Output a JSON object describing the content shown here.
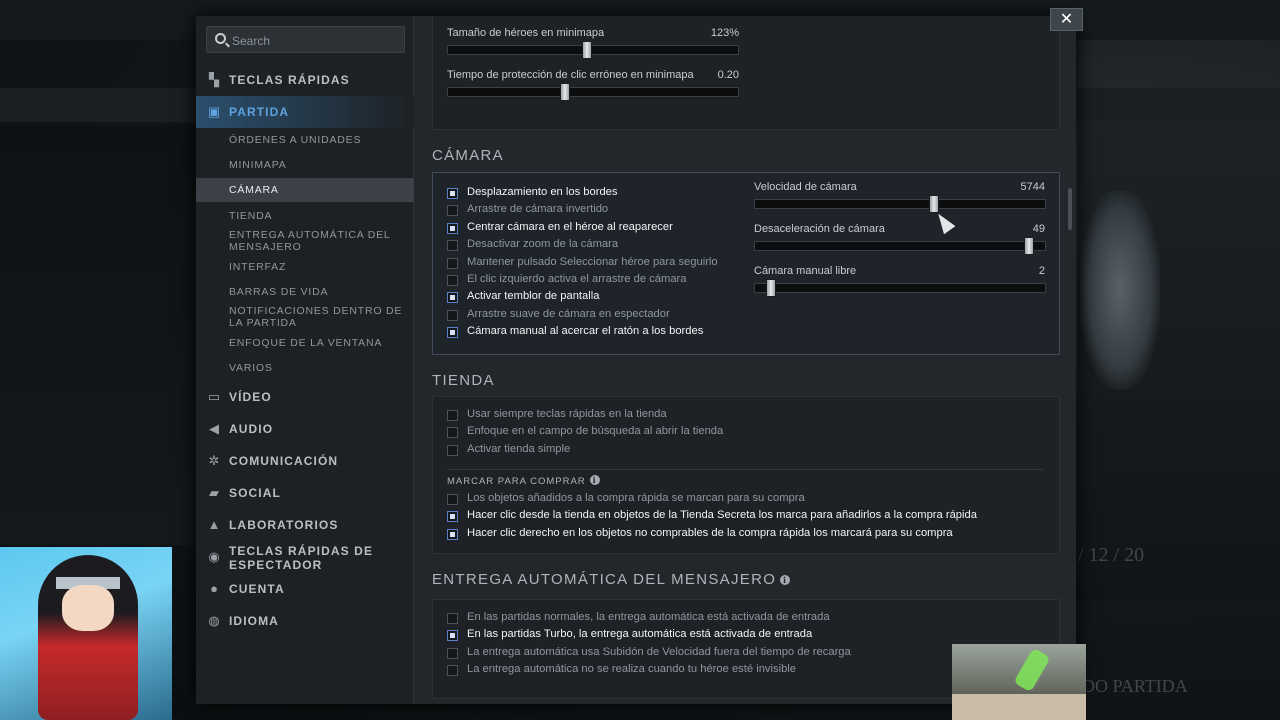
{
  "close_label": "✕",
  "search": {
    "placeholder": "Search"
  },
  "nav": [
    {
      "label": "TECLAS RÁPIDAS",
      "icon": "hotkeys-icon"
    },
    {
      "label": "PARTIDA",
      "icon": "game-icon"
    },
    {
      "label": "VÍDEO",
      "icon": "monitor-icon"
    },
    {
      "label": "AUDIO",
      "icon": "speaker-icon"
    },
    {
      "label": "COMUNICACIÓN",
      "icon": "gear-icon"
    },
    {
      "label": "SOCIAL",
      "icon": "chat-icon"
    },
    {
      "label": "LABORATORIOS",
      "icon": "flask-icon"
    },
    {
      "label": "TECLAS RÁPIDAS DE ESPECTADOR",
      "icon": "spectator-icon"
    },
    {
      "label": "CUENTA",
      "icon": "user-icon"
    },
    {
      "label": "IDIOMA",
      "icon": "globe-icon"
    }
  ],
  "subnav": [
    "ÓRDENES A UNIDADES",
    "MINIMAPA",
    "CÁMARA",
    "TIENDA",
    "ENTREGA AUTOMÁTICA DEL MENSAJERO",
    "INTERFAZ",
    "BARRAS DE VIDA",
    "NOTIFICACIONES DENTRO DE LA PARTIDA",
    "ENFOQUE DE LA VENTANA",
    "VARIOS"
  ],
  "minimap": {
    "hero_size": {
      "label": "Tamaño de héroes en minimapa",
      "value": "123%",
      "fraction": 0.48
    },
    "misclick": {
      "label": "Tiempo de protección de clic erróneo en minimapa",
      "value": "0.20",
      "fraction": 0.4
    }
  },
  "camera": {
    "title": "CÁMARA",
    "checks": [
      {
        "label": "Desplazamiento en los bordes",
        "on": true
      },
      {
        "label": "Arrastre de cámara invertido",
        "on": false
      },
      {
        "label": "Centrar cámara en el héroe al reaparecer",
        "on": true
      },
      {
        "label": "Desactivar zoom de la cámara",
        "on": false
      },
      {
        "label": "Mantener pulsado Seleccionar héroe para seguirlo",
        "on": false
      },
      {
        "label": "El clic izquierdo activa el arrastre de cámara",
        "on": false
      },
      {
        "label": "Activar temblor de pantalla",
        "on": true
      },
      {
        "label": "Arrastre suave de cámara en espectador",
        "on": false
      },
      {
        "label": "Cámara manual al acercar el ratón a los bordes",
        "on": true
      }
    ],
    "sliders": [
      {
        "label": "Velocidad de cámara",
        "value": "5744",
        "fraction": 0.62
      },
      {
        "label": "Desaceleración de cámara",
        "value": "49",
        "fraction": 0.96
      },
      {
        "label": "Cámara manual libre",
        "value": "2",
        "fraction": 0.04
      }
    ]
  },
  "shop": {
    "title": "TIENDA",
    "checks": [
      {
        "label": "Usar siempre teclas rápidas en la tienda",
        "on": false
      },
      {
        "label": "Enfoque en el campo de búsqueda al abrir la tienda",
        "on": false
      },
      {
        "label": "Activar tienda simple",
        "on": false
      }
    ],
    "mark_title": "MARCAR PARA COMPRAR",
    "mark_checks": [
      {
        "label": "Los objetos añadidos a la compra rápida se marcan para su compra",
        "on": false
      },
      {
        "label": "Hacer clic desde la tienda en objetos de la Tienda Secreta los marca para añadirlos a la compra rápida",
        "on": true
      },
      {
        "label": "Hacer clic derecho en los objetos no comprables de la compra rápida los marcará para su compra",
        "on": true
      }
    ]
  },
  "courier": {
    "title": "ENTREGA AUTOMÁTICA DEL MENSAJERO",
    "checks": [
      {
        "label": "En las partidas normales, la entrega automática está activada de entrada",
        "on": false
      },
      {
        "label": "En las partidas Turbo, la entrega automática está activada de entrada",
        "on": true
      },
      {
        "label": "La entrega automática usa Subidón de Velocidad fuera del tiempo de recarga",
        "on": false
      },
      {
        "label": "La entrega automática no se realiza cuando tu héroe esté invisible",
        "on": false
      }
    ]
  },
  "background": {
    "right_text_1": "/ 12 / 20",
    "right_text_2": "DO PARTIDA"
  }
}
